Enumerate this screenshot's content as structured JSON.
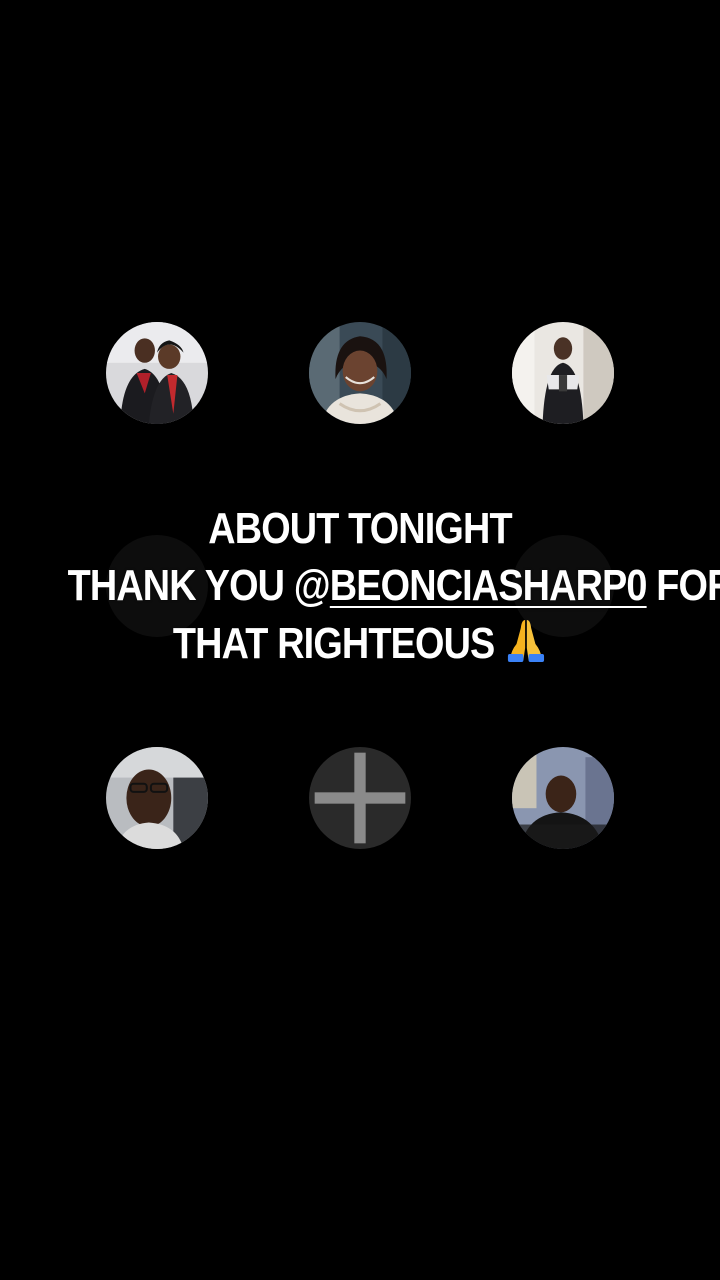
{
  "caption": {
    "line1": "ABOUT TONIGHT",
    "line2_prefix": "THANK YOU @",
    "mention": "BEONCIASHARP0",
    "line2_suffix": " FOR",
    "line3": "THAT RIGHTEOUS"
  },
  "emoji_icon": "folded-hands-icon",
  "add_icon": "plus-icon",
  "colors": {
    "background": "#000000",
    "text": "#ffffff",
    "add_button_bg": "#2a2a2a",
    "add_icon": "#8a8a8a"
  }
}
